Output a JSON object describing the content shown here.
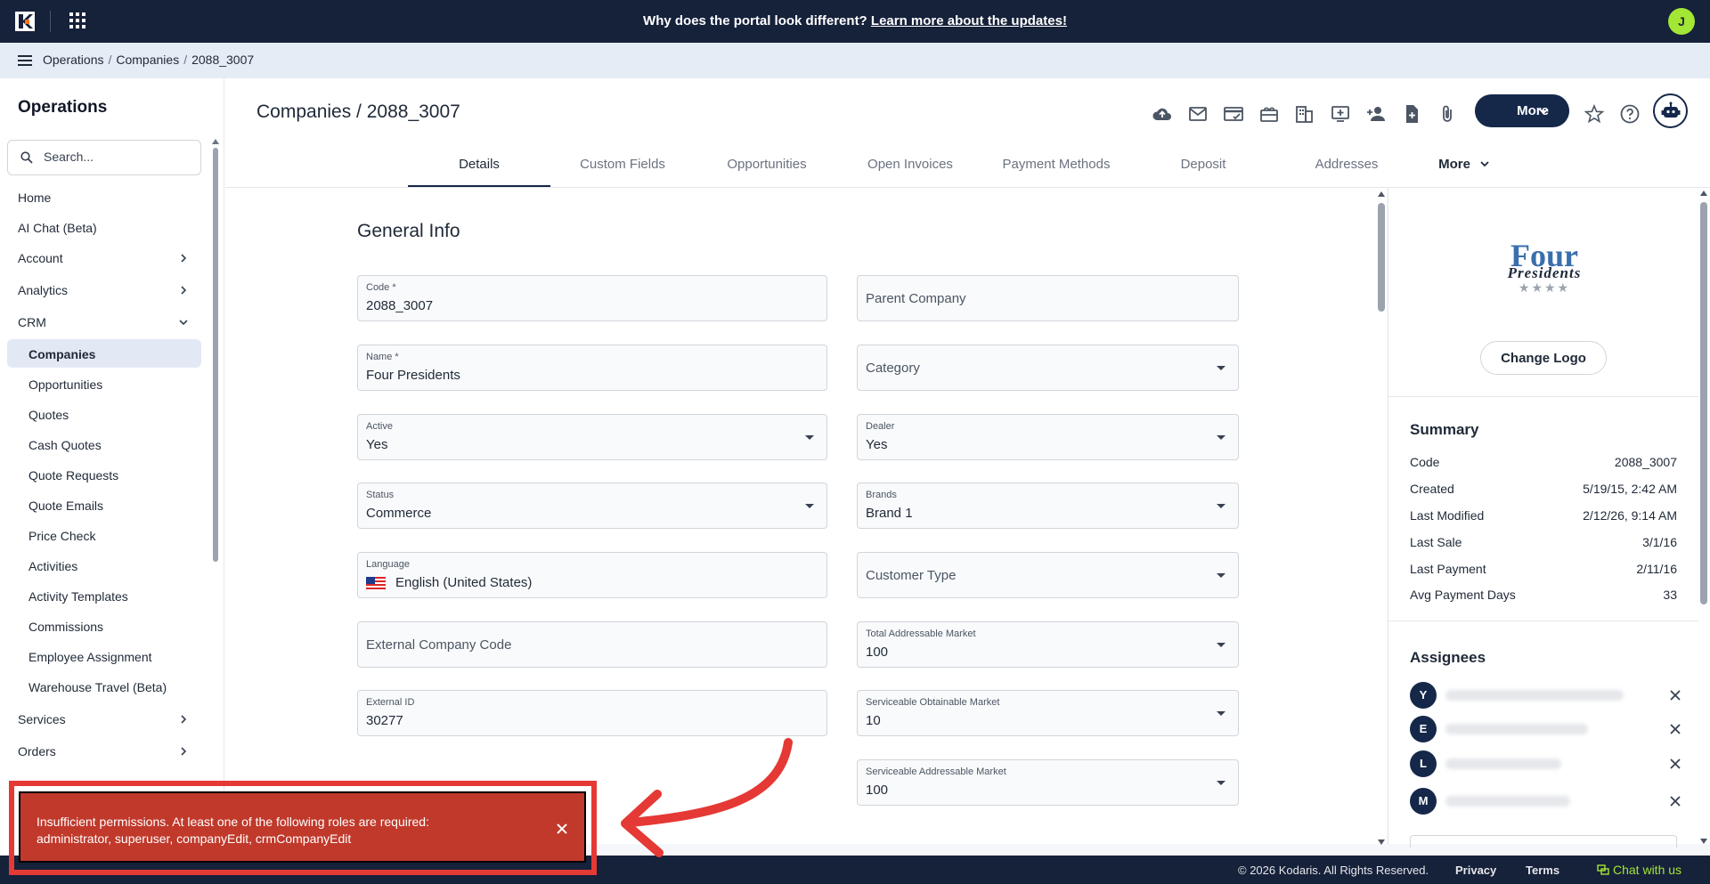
{
  "topbar": {
    "announcement": "Why does the portal look different?",
    "announcement_link": "Learn more about the updates!",
    "user_initial": "J"
  },
  "breadcrumb": [
    "Operations",
    "Companies",
    "2088_3007"
  ],
  "sidebar": {
    "title": "Operations",
    "search_placeholder": "Search...",
    "items": [
      {
        "label": "Home"
      },
      {
        "label": "AI Chat (Beta)"
      },
      {
        "label": "Account"
      },
      {
        "label": "Analytics"
      },
      {
        "label": "CRM"
      },
      {
        "label": "Companies"
      },
      {
        "label": "Opportunities"
      },
      {
        "label": "Quotes"
      },
      {
        "label": "Cash Quotes"
      },
      {
        "label": "Quote Requests"
      },
      {
        "label": "Quote Emails"
      },
      {
        "label": "Price Check"
      },
      {
        "label": "Activities"
      },
      {
        "label": "Activity Templates"
      },
      {
        "label": "Commissions"
      },
      {
        "label": "Employee Assignment"
      },
      {
        "label": "Warehouse Travel (Beta)"
      },
      {
        "label": "Services"
      },
      {
        "label": "Orders"
      }
    ]
  },
  "page": {
    "title": "Companies / 2088_3007",
    "more_label": "More",
    "tabs": [
      "Details",
      "Custom Fields",
      "Opportunities",
      "Open Invoices",
      "Payment Methods",
      "Deposit",
      "Addresses",
      "More"
    ]
  },
  "form": {
    "heading": "General Info",
    "code": {
      "label": "Code *",
      "value": "2088_3007"
    },
    "parent_company": {
      "placeholder": "Parent Company"
    },
    "name": {
      "label": "Name *",
      "value": "Four Presidents"
    },
    "category": {
      "placeholder": "Category"
    },
    "active": {
      "label": "Active",
      "value": "Yes"
    },
    "dealer": {
      "label": "Dealer",
      "value": "Yes"
    },
    "status": {
      "label": "Status",
      "value": "Commerce"
    },
    "brands": {
      "label": "Brands",
      "value": "Brand 1"
    },
    "language": {
      "label": "Language",
      "value": "English (United States)"
    },
    "customer_type": {
      "placeholder": "Customer Type"
    },
    "external_company_code": {
      "placeholder": "External Company Code"
    },
    "tam": {
      "label": "Total Addressable Market",
      "value": "100"
    },
    "external_id": {
      "label": "External ID",
      "value": "30277"
    },
    "som": {
      "label": "Serviceable Obtainable Market",
      "value": "10"
    },
    "sam": {
      "label": "Serviceable Addressable Market",
      "value": "100"
    }
  },
  "right": {
    "logo_line1": "Four",
    "logo_line2": "Presidents",
    "logo_stars": "★★★★",
    "change_logo": "Change Logo",
    "summary_title": "Summary",
    "summary": [
      {
        "k": "Code",
        "v": "2088_3007"
      },
      {
        "k": "Created",
        "v": "5/19/15, 2:42 AM"
      },
      {
        "k": "Last Modified",
        "v": "2/12/26, 9:14 AM"
      },
      {
        "k": "Last Sale",
        "v": "3/1/16"
      },
      {
        "k": "Last Payment",
        "v": "2/11/16"
      },
      {
        "k": "Avg Payment Days",
        "v": "33"
      }
    ],
    "assignees_title": "Assignees",
    "assignees": [
      {
        "initial": "Y"
      },
      {
        "initial": "E"
      },
      {
        "initial": "L"
      },
      {
        "initial": "M"
      }
    ]
  },
  "footer": {
    "copyright": "© 2026 Kodaris. All Rights Reserved.",
    "privacy": "Privacy",
    "terms": "Terms",
    "chat": "Chat with us"
  },
  "toast": {
    "message": "Insufficient permissions. At least one of the following roles are required: administrator, superuser, companyEdit, crmCompanyEdit"
  },
  "colors": {
    "navy": "#15284a",
    "alert": "#c0392b",
    "highlight": "#e53935",
    "accent": "#a3e635"
  }
}
